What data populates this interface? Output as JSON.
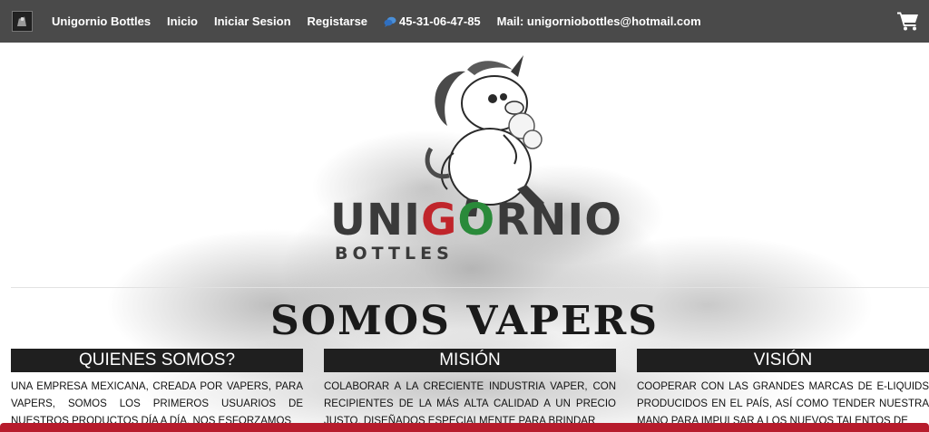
{
  "navbar": {
    "logo_icon": "site-logo-icon",
    "links": [
      {
        "label": "Unigornio Bottles"
      },
      {
        "label": "Inicio"
      },
      {
        "label": "Iniciar Sesion"
      },
      {
        "label": "Registarse"
      }
    ],
    "phone_icon": "chat-bubble-icon",
    "phone": "45-31-06-47-85",
    "mail": "Mail: unigorniobottles@hotmail.com",
    "cart_icon": "shopping-cart-icon",
    "background": "#4a4a4a"
  },
  "hero": {
    "mascot_icon": "unicorn-mascot-icon",
    "brand_name_parts": [
      "UNI",
      "G",
      "O",
      "RNIO"
    ],
    "brand_sub": "BOTTLES",
    "headline": "SOMOS VAPERS"
  },
  "columns": [
    {
      "title": "QUIENES SOMOS?",
      "text": "UNA EMPRESA MEXICANA, CREADA POR VAPERS, PARA VAPERS, SOMOS LOS PRIMEROS USUARIOS DE NUESTROS PRODUCTOS DÍA A DÍA, NOS ESFORZAMOS"
    },
    {
      "title": "MISIÓN",
      "text": "COLABORAR A LA CRECIENTE INDUSTRIA VAPER, CON RECIPIENTES DE LA MÁS ALTA CALIDAD A UN PRECIO JUSTO, DISEÑADOS ESPECIALMENTE PARA BRINDAR"
    },
    {
      "title": "VISIÓN",
      "text": "COOPERAR CON LAS GRANDES MARCAS DE E-LIQUIDS PRODUCIDOS EN EL PAÍS, ASÍ COMO TENDER NUESTRA MANO PARA IMPULSAR A LOS NUEVOS TALENTOS DE"
    }
  ],
  "colors": {
    "accent_red": "#b71c2c",
    "brand_green": "#2a8a3a",
    "brand_red": "#c0252b",
    "header_bar": "#1f1f1f"
  }
}
